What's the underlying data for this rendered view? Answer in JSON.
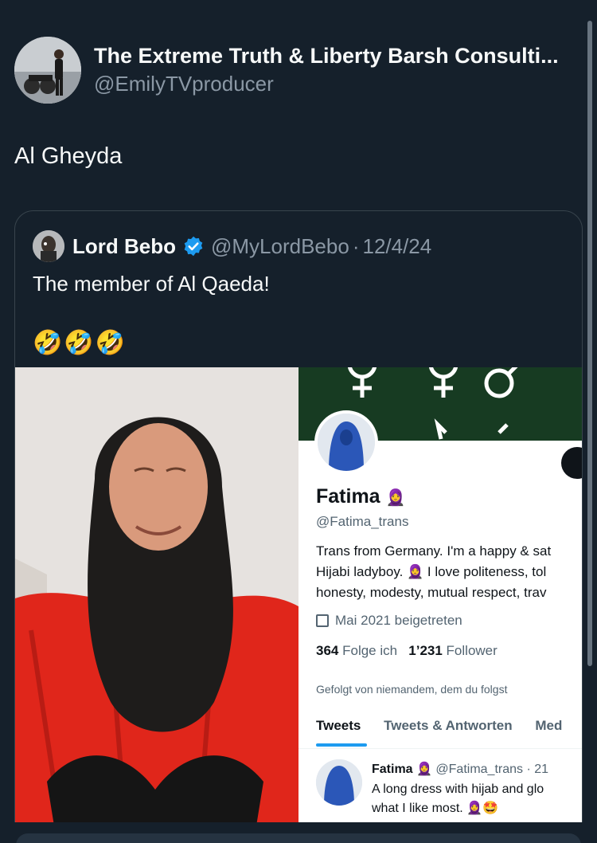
{
  "post": {
    "author_name": "The Extreme Truth & Liberty Barsh Consulti...",
    "author_handle": "@EmilyTVproducer",
    "text": "Al Gheyda"
  },
  "quote": {
    "author_name": "Lord Bebo",
    "author_handle": "@MyLordBebo",
    "date": "12/4/24",
    "separator": "·",
    "text": "The member of Al Qaeda!",
    "emoji": "🤣🤣🤣"
  },
  "profile_screenshot": {
    "name": "Fatima",
    "name_emoji": "🧕",
    "handle": "@Fatima_trans",
    "bio_lines": [
      "Trans from Germany. I'm a happy & sat",
      "Hijabi ladyboy. 🧕 I love politeness, tol",
      "honesty, modesty, mutual respect, trav"
    ],
    "joined": "Mai 2021 beigetreten",
    "following_count": "364",
    "following_label": "Folge ich",
    "followers_count": "1’231",
    "followers_label": "Follower",
    "followed_by": "Gefolgt von niemandem, dem du folgst",
    "tabs": [
      "Tweets",
      "Tweets & Antworten",
      "Med"
    ],
    "tweet": {
      "name": "Fatima",
      "emoji": "🧕",
      "handle": "@Fatima_trans",
      "time": "· 21",
      "line1": "A long dress with hijab and glo",
      "line2": "what I like most. 🧕🤩"
    }
  },
  "colors": {
    "background": "#15202b",
    "text_primary": "#f7f9f9",
    "text_secondary": "#8b98a5",
    "border": "#38444d",
    "verified_blue": "#1d9bf0"
  }
}
